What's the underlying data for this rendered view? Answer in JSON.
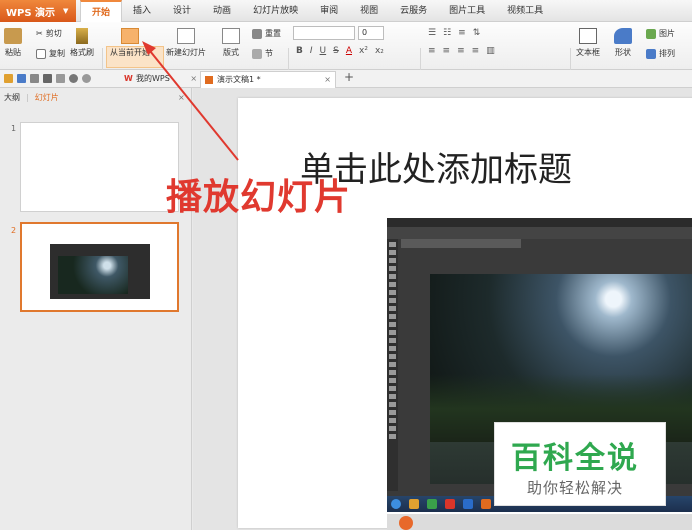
{
  "app": {
    "name": "WPS 演示"
  },
  "tabs": [
    "开始",
    "插入",
    "设计",
    "动画",
    "幻灯片放映",
    "审阅",
    "视图",
    "云服务",
    "图片工具",
    "视频工具"
  ],
  "active_tab": "开始",
  "ribbon": {
    "paste": "粘贴",
    "cut": "剪切",
    "copy": "复制",
    "format_painter": "格式刷",
    "play_from_current": "从当前开始",
    "new_slide": "新建幻灯片",
    "layout": "版式",
    "reset": "重置",
    "section": "节",
    "font_size": "0",
    "text_box": "文本框",
    "shape": "形状",
    "picture": "图片",
    "arrange": "排列"
  },
  "doc_tabs": [
    {
      "label": "我的WPS",
      "active": false
    },
    {
      "label": "演示文稿1 *",
      "active": true
    }
  ],
  "left_panel": {
    "tab_outline": "大纲",
    "tab_slides": "幻灯片",
    "thumbs": [
      "1",
      "2"
    ]
  },
  "slide": {
    "title_placeholder": "单击此处添加标题"
  },
  "annotation": {
    "text": "播放幻灯片",
    "color": "#e0392f"
  },
  "watermark": {
    "title": "百科全说",
    "subtitle": "助你轻松解决"
  },
  "colors": {
    "accent": "#e06b1f",
    "brand_green": "#2fa84f"
  }
}
